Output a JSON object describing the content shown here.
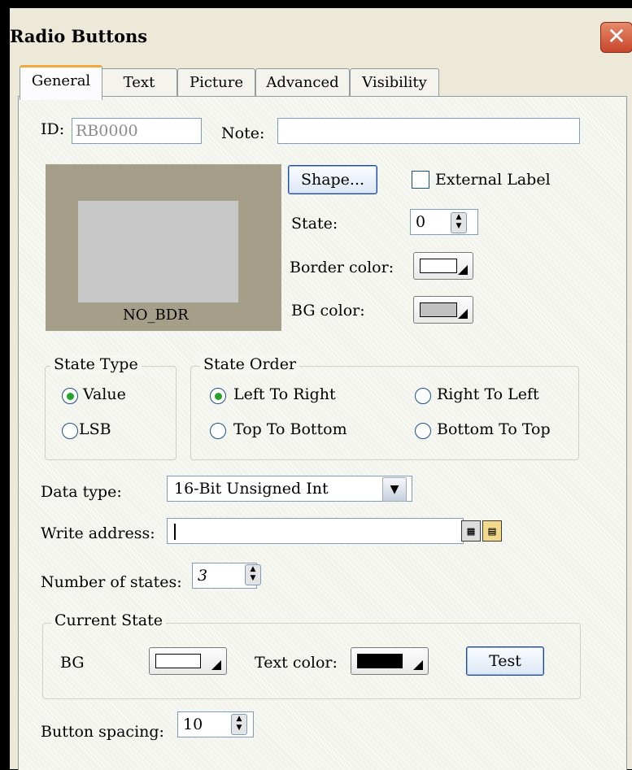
{
  "window": {
    "title": "Radio Buttons",
    "close_icon": "close-icon"
  },
  "tabs": [
    {
      "label": "General",
      "active": true
    },
    {
      "label": "Text"
    },
    {
      "label": "Picture"
    },
    {
      "label": "Advanced"
    },
    {
      "label": "Visibility"
    }
  ],
  "id": {
    "label": "ID:",
    "value": "RB0000"
  },
  "note": {
    "label": "Note:",
    "value": ""
  },
  "preview": {
    "label": "NO_BDR"
  },
  "shape_button": "Shape...",
  "external_label": {
    "label": "External Label",
    "checked": false
  },
  "state": {
    "label": "State:",
    "value": "0"
  },
  "border_color": {
    "label": "Border color:",
    "color": "#ffffff"
  },
  "bg_color": {
    "label": "BG color:",
    "color": "#c0c0c0"
  },
  "state_type": {
    "legend": "State Type",
    "options": [
      {
        "label": "Value",
        "selected": true
      },
      {
        "label": "LSB",
        "selected": false
      }
    ]
  },
  "state_order": {
    "legend": "State Order",
    "options": [
      {
        "label": "Left To Right",
        "selected": true
      },
      {
        "label": "Right To Left",
        "selected": false
      },
      {
        "label": "Top To Bottom",
        "selected": false
      },
      {
        "label": "Bottom To Top",
        "selected": false
      }
    ]
  },
  "data_type": {
    "label": "Data type:",
    "value": "16-Bit Unsigned Int"
  },
  "write_address": {
    "label": "Write address:",
    "value": ""
  },
  "number_of_states": {
    "label": "Number of states:",
    "value": "3"
  },
  "current_state": {
    "legend": "Current State",
    "bg_label": "BG",
    "bg_color": "#ffffff",
    "text_color_label": "Text color:",
    "text_color": "#000000",
    "test_button": "Test"
  },
  "button_spacing": {
    "label": "Button spacing:",
    "value": "10"
  },
  "colors": {
    "preview_outer": "#a59f8a",
    "preview_inner": "#c8c8c8",
    "radio_dot": "#25a32a",
    "tab_highlight": "#f2a83a"
  }
}
